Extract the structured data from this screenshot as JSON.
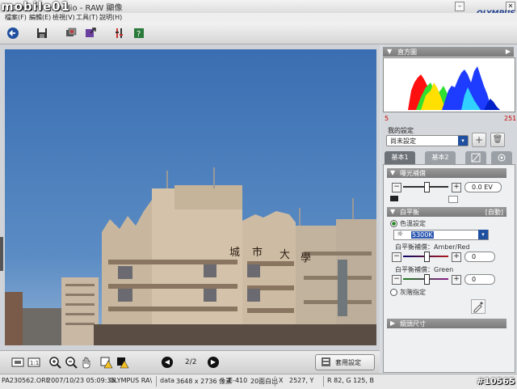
{
  "window": {
    "title": "OLYMPUS Studio - RAW 顯像",
    "watermark": "mobile01",
    "brand": "OLYMPUS",
    "minimize_glyph": "–",
    "close_glyph": "✕"
  },
  "menu": [
    "檔案(F)",
    "編輯(E)",
    "檢視(V)",
    "工具(T)",
    "說明(H)"
  ],
  "toolbar_icons": [
    "back-arrow-icon",
    "save-icon",
    "batch-develop-icon",
    "export-icon",
    "tools-icon",
    "help-icon"
  ],
  "viewer": {
    "page": "2/2",
    "prev_glyph": "◀",
    "next_glyph": "▶",
    "apply_label": "套用設定"
  },
  "status": {
    "filename": "PA230562.ORF",
    "datetime": "2007/10/23 05:09:36",
    "camera": "OLYMPUS RA\\",
    "data": "data",
    "dimensions": "3648 x 2736 像素",
    "model": "E-410",
    "iso": "20面白出",
    "x": "X",
    "coords": "2527, Y",
    "rgb": "R   82, G   125, B",
    "id_mark": "#10565"
  },
  "histogram": {
    "title": "直方圖",
    "min": "5",
    "max": "251"
  },
  "preset": {
    "label": "我的設定",
    "value": "尚未設定",
    "dropdown_glyph": "▾",
    "add_glyph": "+",
    "delete_glyph": "🗑"
  },
  "tabs": [
    "基本1",
    "基本2",
    "",
    ""
  ],
  "exposure": {
    "title": "曝光補償",
    "value": "0.0 EV",
    "minus": "−",
    "plus": "+"
  },
  "white_balance": {
    "title": "白平衡",
    "auto_badge": "[自動]",
    "auto_label": "色溫設定",
    "temp_value": "5300K",
    "amber_label": "白平衡補償：Amber/Red",
    "amber_value": "0",
    "green_label": "白平衡補償：Green",
    "green_value": "0",
    "gray_label": "灰階指定",
    "minus": "−",
    "plus": "+"
  },
  "more_section": {
    "title": "鏡頭尺寸"
  },
  "colors": {
    "sky": "#3f78b8",
    "accent_blue": "#1f4f9f",
    "panel_header": "#7a7a7a"
  }
}
